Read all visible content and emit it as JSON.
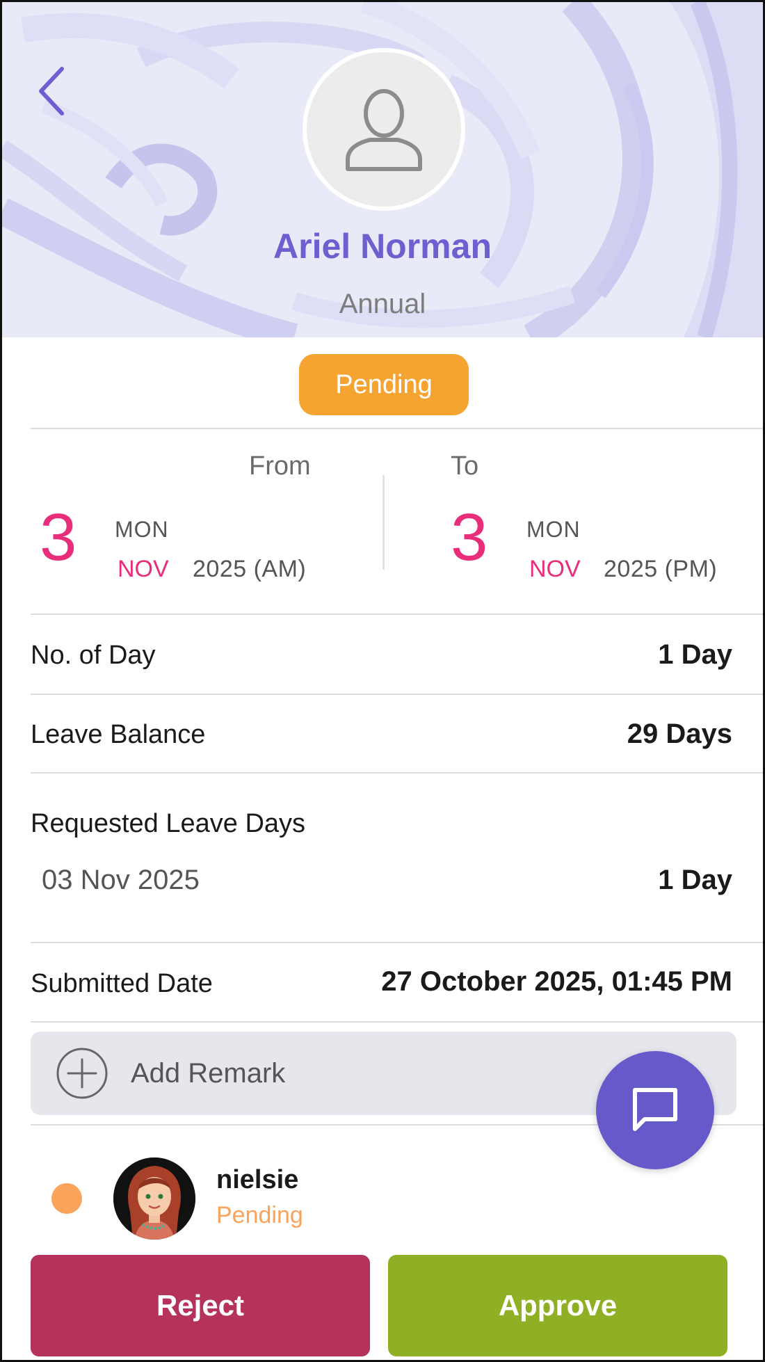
{
  "header": {
    "employee_name": "Ariel Norman",
    "leave_type": "Annual",
    "back_icon": "chevron-left-icon",
    "avatar_icon": "user-placeholder-icon"
  },
  "status": {
    "label": "Pending",
    "color": "#f5a431"
  },
  "date_range": {
    "from": {
      "heading": "From",
      "day": "3",
      "weekday": "MON",
      "month": "NOV",
      "year_period": "2025 (AM)"
    },
    "to": {
      "heading": "To",
      "day": "3",
      "weekday": "MON",
      "month": "NOV",
      "year_period": "2025 (PM)"
    }
  },
  "details": {
    "no_of_day": {
      "label": "No. of Day",
      "value": "1 Day"
    },
    "leave_balance": {
      "label": "Leave Balance",
      "value": "29 Days"
    },
    "requested": {
      "label": "Requested Leave Days",
      "items": [
        {
          "date": "03 Nov 2025",
          "value": "1 Day"
        }
      ]
    },
    "submitted": {
      "label": "Submitted Date",
      "value": "27 October 2025, 01:45 PM"
    }
  },
  "remark": {
    "label": "Add Remark",
    "icon": "add-circle-icon"
  },
  "chat_fab": {
    "icon": "chat-bubble-icon"
  },
  "approvers": [
    {
      "name": "nielsie",
      "status": "Pending",
      "status_color": "#f9a45a"
    }
  ],
  "actions": {
    "reject": "Reject",
    "approve": "Approve"
  },
  "colors": {
    "accent": "#6c5fcf",
    "date_accent": "#e82d7a",
    "reject": "#b5325a",
    "approve": "#8fb024"
  }
}
